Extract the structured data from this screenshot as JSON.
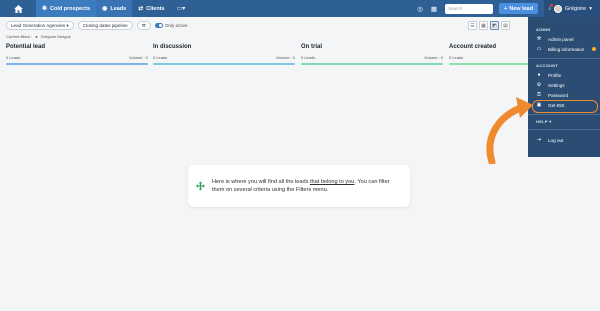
{
  "nav": {
    "tabs": [
      {
        "label": "Cold prospects",
        "icon": "snowflake-icon"
      },
      {
        "label": "Leads",
        "icon": "target-icon"
      },
      {
        "label": "Clients",
        "icon": "handshake-icon"
      }
    ],
    "search_placeholder": "Search",
    "new_lead_label": "New lead",
    "user_name": "Grégoire"
  },
  "filters": {
    "agency": "Lead Generation Agencies",
    "pipeline": "Closing dates pipeline",
    "only_active": "Only active",
    "current_label": "Current filters :",
    "current_value": "Grégoire Morgue"
  },
  "columns": [
    {
      "title": "Potential lead",
      "leads": "0 Leads",
      "volume": "Volume : 0",
      "color": "#7fb2e5"
    },
    {
      "title": "In discussion",
      "leads": "0 Leads",
      "volume": "Volume : 0",
      "color": "#7ec9e0"
    },
    {
      "title": "On trial",
      "leads": "0 Leads",
      "volume": "Volume : 0",
      "color": "#7ddbb7"
    },
    {
      "title": "Account created",
      "leads": "0 Leads",
      "volume": "",
      "color": "#8fe3a6"
    }
  ],
  "menu": {
    "admin_section": "ADMIN",
    "admin_panel": "Admin panel",
    "billing": "Billing information",
    "account_section": "ACCOUNT",
    "profile": "Profile",
    "settings": "Settings",
    "password": "Password",
    "get_reward": "Get €50",
    "help_section": "HELP",
    "logout": "Log out"
  },
  "empty_state": {
    "text_before": "Here is where you will find all the leads ",
    "link": "that belong to you",
    "text_after": ". You can filter them on several criteria using the Filters menu."
  },
  "colors": {
    "topbar": "#2e5f95",
    "dropdown": "#2b4d73",
    "highlight": "#f08a2e"
  }
}
